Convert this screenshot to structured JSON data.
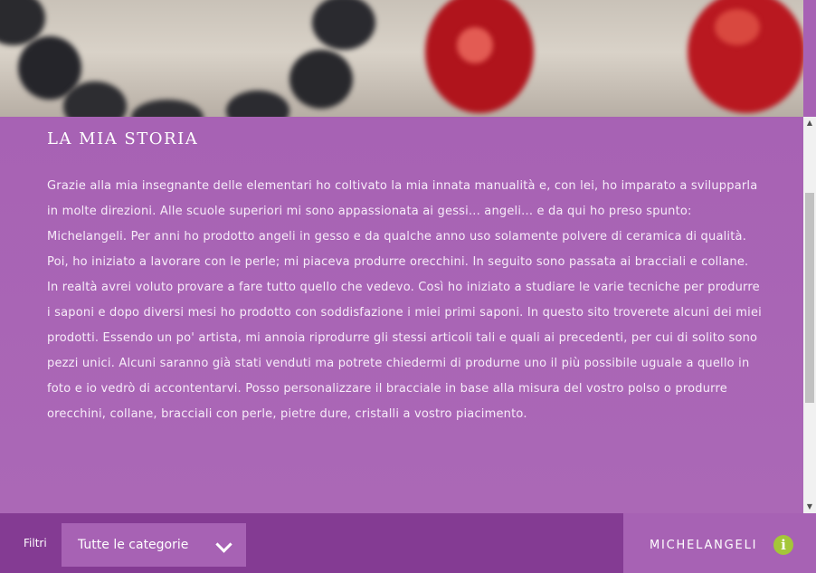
{
  "hero": {
    "image": "bead-bracelet-photo"
  },
  "story": {
    "title": "LA MIA STORIA",
    "text": "Grazie alla mia insegnante delle elementari ho coltivato la mia innata manualità e, con lei, ho imparato a svilupparla in molte direzioni. Alle scuole superiori mi sono appassionata ai gessi... angeli... e da qui ho preso spunto: Michelangeli. Per anni ho prodotto angeli in gesso e da qualche anno uso solamente polvere di ceramica di qualità. Poi, ho iniziato a lavorare con le perle; mi piaceva produrre orecchini. In seguito sono passata ai bracciali e collane. In realtà avrei voluto provare a fare tutto quello che vedevo. Così ho iniziato a studiare le varie tecniche per produrre i saponi e dopo diversi mesi ho prodotto con soddisfazione i miei primi saponi. In questo sito troverete alcuni dei miei prodotti. Essendo un po'  artista, mi annoia riprodurre gli stessi articoli tali e quali ai precedenti, per cui di solito sono pezzi unici. Alcuni saranno già stati venduti ma potrete chiedermi di produrne uno il più possibile uguale a quello in foto e io vedrò di accontentarvi. Posso personalizzare il bracciale in base alla misura del vostro polso o produrre orecchini, collane, bracciali con perle, pietre dure, cristalli a vostro piacimento."
  },
  "filters": {
    "label": "Filtri",
    "selected": "Tutte le categorie",
    "chevron_icon": "chevron-down-icon"
  },
  "brand": {
    "name": "MICHELANGELI",
    "info_icon": "info-icon",
    "info_glyph": "i"
  },
  "colors": {
    "content_bg": "#a762b4",
    "filter_bar": "#843b93",
    "info_accent": "#a4c639"
  }
}
